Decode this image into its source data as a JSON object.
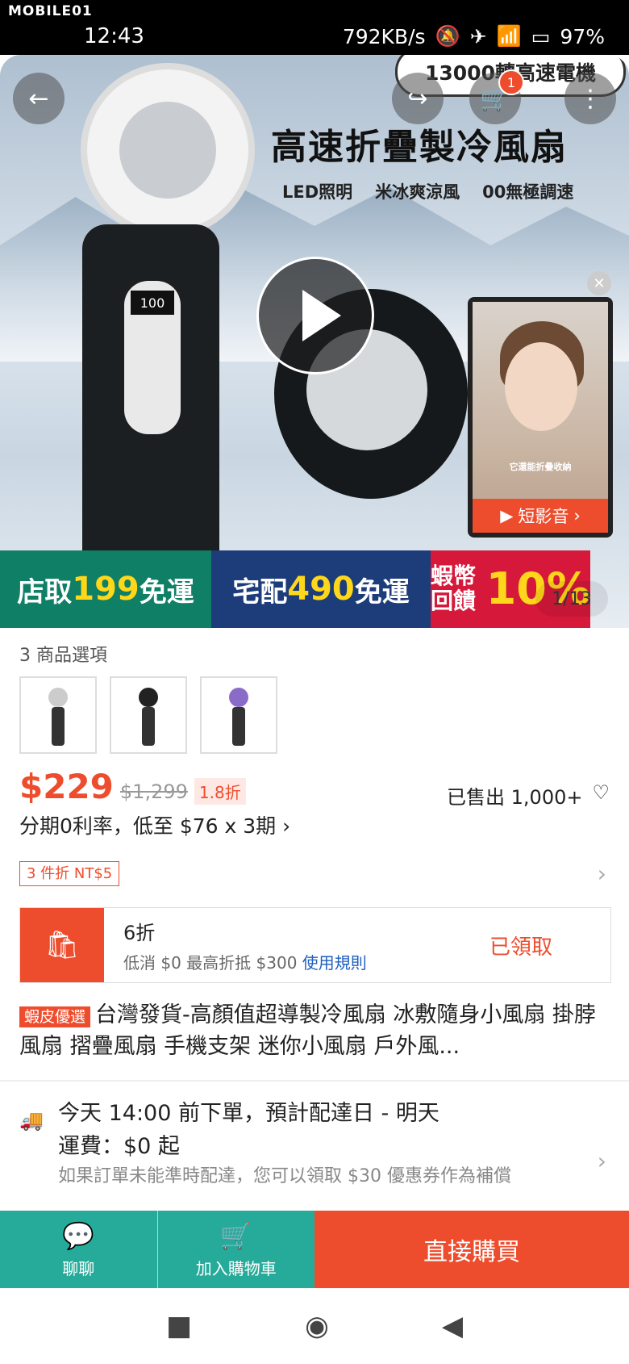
{
  "status": {
    "brand": "MOBILE01",
    "time": "12:43",
    "speed": "792KB/s",
    "battery": "97%"
  },
  "hero": {
    "top_pill": "13000轉高速電機",
    "title": "高速折疊製冷風扇",
    "features": [
      "LED照明",
      "米冰爽涼風",
      "00無極調速"
    ],
    "digits": "100",
    "cart_badge": "1",
    "mini_caption": "它還能折疊收納",
    "mini_label": "短影音",
    "pager": "1/13"
  },
  "banner": {
    "pickup": "店取",
    "pickup_amt": "199",
    "pickup_tail": "免運",
    "home": "宅配",
    "home_amt": "490",
    "home_tail": "免運",
    "coin": "蝦幣回饋",
    "coin_pct": "10%"
  },
  "product": {
    "options_label": "3 商品選項",
    "price": "$229",
    "orig_price": "$1,299",
    "discount": "1.8折",
    "sold": "已售出 1,000+",
    "installment": "分期0利率，低至 $76 x 3期 ›",
    "bundle": "3 件折 NT$5",
    "voucher": {
      "title": "6折",
      "sub": "低消 $0 最高折抵 $300",
      "rule_link": "使用規則",
      "status": "已領取"
    },
    "tag": "蝦皮優選",
    "title": "台灣發貨-高顏值超導製冷風扇 冰敷隨身小風扇 掛脖風扇 摺疊風扇 手機支架 迷你小風扇 戶外風..."
  },
  "shipping": {
    "line1": "今天 14:00 前下單，預計配達日 - 明天",
    "line2": "運費：$0 起",
    "note": "如果訂單未能準時配達，您可以領取 $30 優惠券作為補償"
  },
  "actions": {
    "chat": "聊聊",
    "add_cart": "加入購物車",
    "buy_now": "直接購買"
  }
}
